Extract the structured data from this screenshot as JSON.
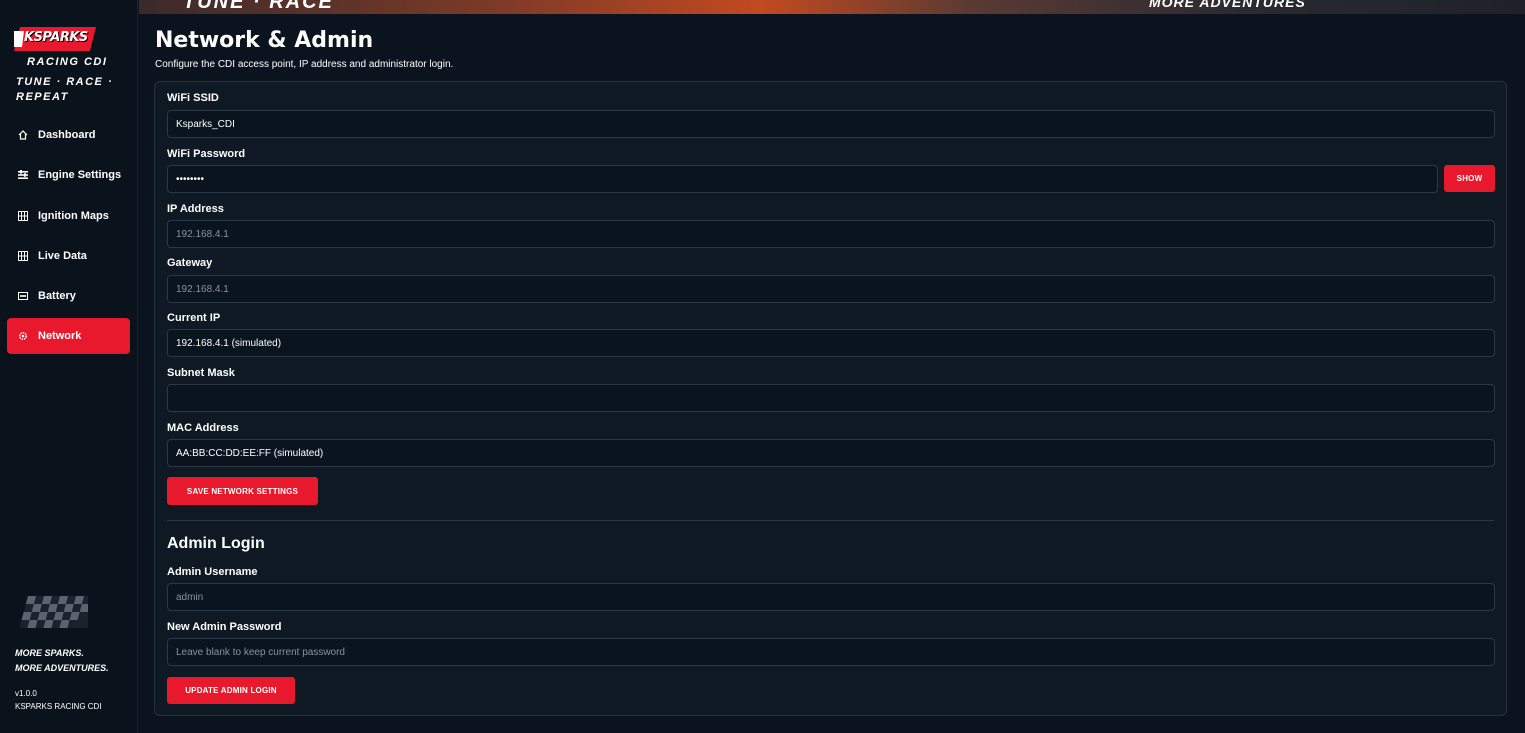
{
  "brand": {
    "logo_text": "KSPARKS",
    "subtitle": "RACING CDI",
    "tagline": "TUNE · RACE · REPEAT",
    "motto_line1": "MORE SPARKS.",
    "motto_line2": "MORE ADVENTURES.",
    "version": "v1.0.0",
    "company": "KSPARKS RACING CDI",
    "accent_color": "#e8192c"
  },
  "banner": {
    "text_left": "TUNE · RACE",
    "text_right": "MORE ADVENTURES"
  },
  "sidebar": {
    "items": [
      {
        "label": "Dashboard",
        "icon": "home-icon",
        "active": false
      },
      {
        "label": "Engine Settings",
        "icon": "sliders-icon",
        "active": false
      },
      {
        "label": "Ignition Maps",
        "icon": "grid-icon",
        "active": false
      },
      {
        "label": "Live Data",
        "icon": "grid-icon",
        "active": false
      },
      {
        "label": "Battery",
        "icon": "battery-icon",
        "active": false
      },
      {
        "label": "Network",
        "icon": "gear-icon",
        "active": true
      }
    ]
  },
  "page": {
    "title": "Network & Admin",
    "subtitle": "Configure the CDI access point, IP address and administrator login."
  },
  "network": {
    "ssid_label": "WiFi SSID",
    "ssid_value": "Ksparks_CDI",
    "password_label": "WiFi Password",
    "password_value": "••••••••",
    "show_label": "SHOW",
    "ip_label": "IP Address",
    "ip_placeholder": "192.168.4.1",
    "gateway_label": "Gateway",
    "gateway_placeholder": "192.168.4.1",
    "current_ip_label": "Current IP",
    "current_ip_value": "192.168.4.1 (simulated)",
    "subnet_label": "Subnet Mask",
    "subnet_value": "",
    "mac_label": "MAC Address",
    "mac_value": "AA:BB:CC:DD:EE:FF (simulated)",
    "save_label": "SAVE NETWORK SETTINGS"
  },
  "admin": {
    "section_title": "Admin Login",
    "username_label": "Admin Username",
    "username_placeholder": "admin",
    "password_label": "New Admin Password",
    "password_placeholder": "Leave blank to keep current password",
    "update_label": "UPDATE ADMIN LOGIN"
  }
}
